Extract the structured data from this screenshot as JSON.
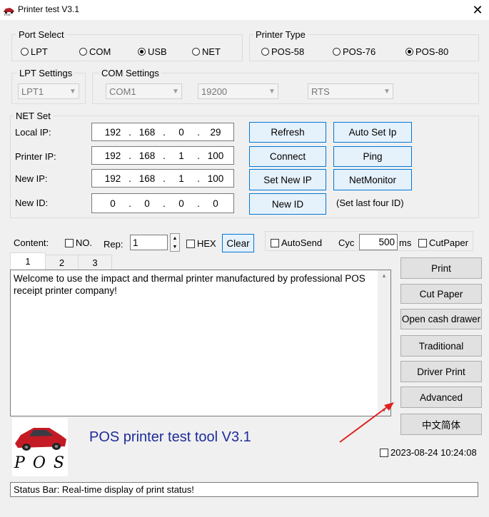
{
  "window": {
    "title": "Printer test V3.1"
  },
  "port_select": {
    "label": "Port Select",
    "options": [
      {
        "label": "LPT",
        "checked": false
      },
      {
        "label": "COM",
        "checked": false
      },
      {
        "label": "USB",
        "checked": true
      },
      {
        "label": "NET",
        "checked": false
      }
    ]
  },
  "printer_type": {
    "label": "Printer Type",
    "options": [
      {
        "label": "POS-58",
        "checked": false
      },
      {
        "label": "POS-76",
        "checked": false
      },
      {
        "label": "POS-80",
        "checked": true
      }
    ]
  },
  "lpt_settings": {
    "label": "LPT Settings",
    "value": "LPT1"
  },
  "com_settings": {
    "label": "COM Settings",
    "port": "COM1",
    "baud": "19200",
    "flow": "RTS"
  },
  "net_set": {
    "label": "NET Set",
    "local_ip": {
      "label": "Local IP:",
      "octets": [
        "192",
        "168",
        "0",
        "29"
      ]
    },
    "printer_ip": {
      "label": "Printer IP:",
      "octets": [
        "192",
        "168",
        "1",
        "100"
      ]
    },
    "new_ip": {
      "label": "New IP:",
      "octets": [
        "192",
        "168",
        "1",
        "100"
      ]
    },
    "new_id": {
      "label": "New ID:",
      "octets": [
        "0",
        "0",
        "0",
        "0"
      ]
    },
    "buttons": {
      "refresh": "Refresh",
      "auto_set_ip": "Auto Set Ip",
      "connect": "Connect",
      "ping": "Ping",
      "set_new_ip": "Set New IP",
      "net_monitor": "NetMonitor",
      "new_id": "New ID"
    },
    "set_last_four_note": "(Set last four ID)"
  },
  "content_row": {
    "content_label": "Content:",
    "no_label": "NO.",
    "rep_label": "Rep:",
    "rep_value": "1",
    "hex_label": "HEX",
    "clear_label": "Clear",
    "autosend_label": "AutoSend",
    "cyc_label": "Cyc",
    "cyc_value": "500",
    "ms_label": "ms",
    "cutpaper_label": "CutPaper"
  },
  "tabs": [
    "1",
    "2",
    "3"
  ],
  "content_text": "Welcome to use the impact and thermal printer manufactured by professional POS receipt printer company!",
  "actions": {
    "print": "Print",
    "cut_paper": "Cut Paper",
    "open_cash_drawer": "Open cash drawer",
    "traditional": "Traditional",
    "driver_print": "Driver Print",
    "advanced": "Advanced",
    "chinese": "中文简体"
  },
  "logo_text": "P O S",
  "app_heading": "POS printer test tool V3.1",
  "datetime": "2023-08-24 10:24:08",
  "status_bar": "Status Bar: Real-time display of print status!",
  "colors": {
    "heading_blue": "#1f2b9a",
    "annotation_arrow": "#e02020",
    "focus_blue": "#0078d7"
  }
}
